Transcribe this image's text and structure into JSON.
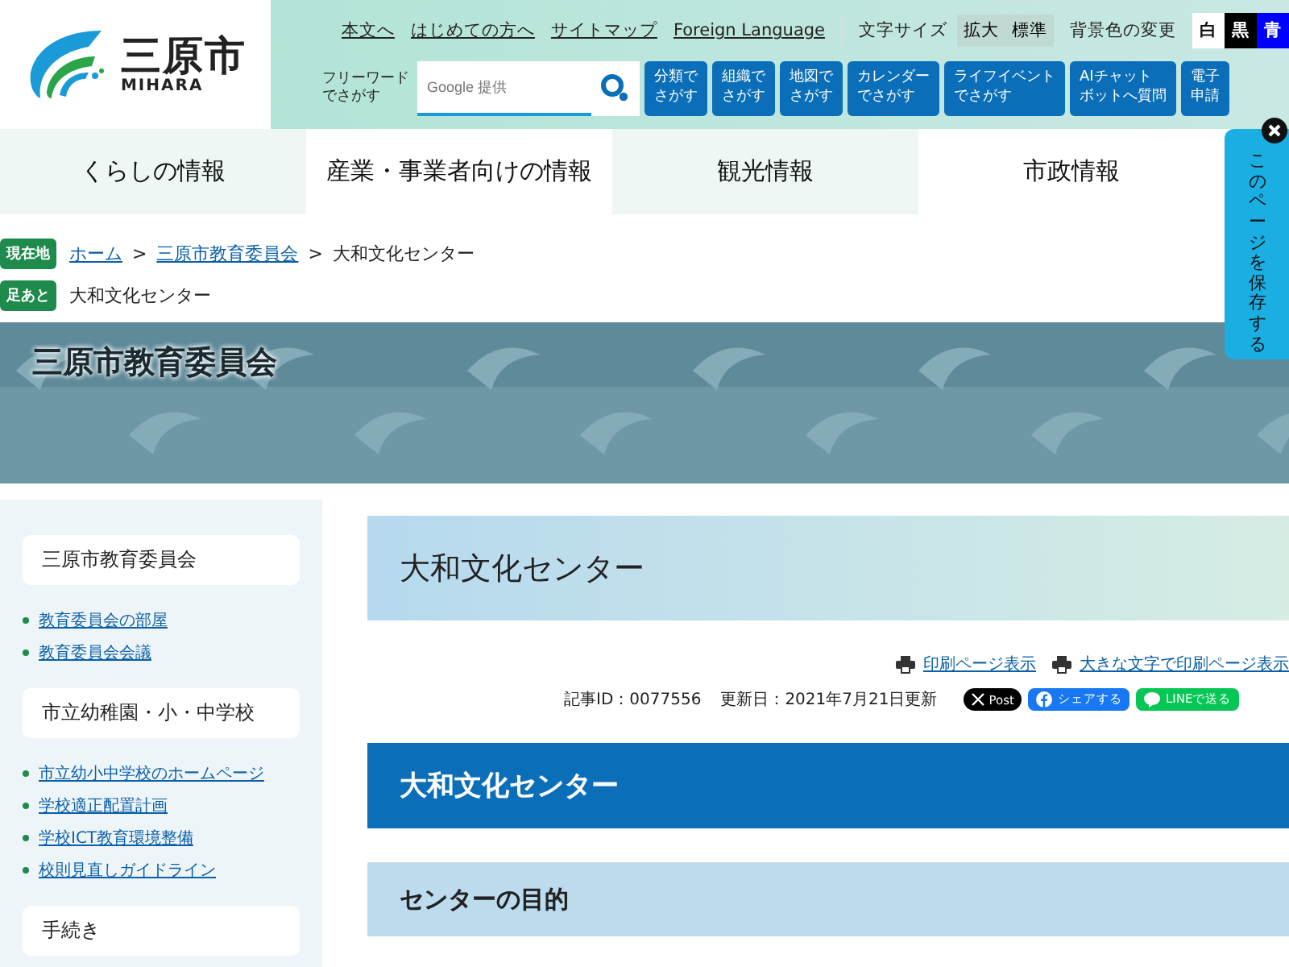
{
  "logo": {
    "name": "三原市",
    "subtitle": "MIHARA"
  },
  "utility_links": [
    "本文へ",
    "はじめての方へ",
    "サイトマップ",
    "Foreign Language"
  ],
  "font_size": {
    "label": "文字サイズ",
    "options": [
      "拡大",
      "標準"
    ]
  },
  "background_color": {
    "label": "背景色の変更",
    "options": [
      {
        "label": "白",
        "color": "#ffffff"
      },
      {
        "label": "黒",
        "color": "#000000"
      },
      {
        "label": "青",
        "color": "#0000ff"
      }
    ]
  },
  "search": {
    "label": [
      "フリーワード",
      "でさがす"
    ],
    "placeholder": "Google 提供"
  },
  "quick_buttons": [
    [
      "分類で",
      "さがす"
    ],
    [
      "組織で",
      "さがす"
    ],
    [
      "地図で",
      "さがす"
    ],
    [
      "カレンダー",
      "でさがす"
    ],
    [
      "ライフイベント",
      "でさがす"
    ],
    [
      "AIチャット",
      "ボットへ質問"
    ],
    [
      "電子",
      "申請"
    ]
  ],
  "main_nav": [
    "くらしの情報",
    "産業・事業者向けの情報",
    "観光情報",
    "市政情報"
  ],
  "breadcrumb": {
    "badge": "現在地",
    "separator": ">",
    "items": [
      {
        "label": "ホーム",
        "link": true
      },
      {
        "label": "三原市教育委員会",
        "link": true
      },
      {
        "label": "大和文化センター",
        "link": false
      }
    ]
  },
  "footprint": {
    "badge": "足あと",
    "text": "大和文化センター"
  },
  "banner": {
    "title": "三原市教育委員会"
  },
  "save_tab": {
    "label": "このページを保存する"
  },
  "sidebar": {
    "sections": [
      {
        "title": "三原市教育委員会",
        "links": [
          "教育委員会の部屋",
          "教育委員会会議"
        ]
      },
      {
        "title": "市立幼稚園・小・中学校",
        "links": [
          "市立幼小中学校のホームページ",
          "学校適正配置計画",
          "学校ICT教育環境整備",
          "校則見直しガイドライン"
        ]
      },
      {
        "title": "手続き"
      }
    ]
  },
  "article": {
    "title": "大和文化センター",
    "print_links": [
      "印刷ページ表示",
      "大きな文字で印刷ページ表示"
    ],
    "article_id": "記事ID：0077556",
    "updated": "更新日：2021年7月21日更新",
    "share_buttons": [
      {
        "kind": "x",
        "label": "Post"
      },
      {
        "kind": "facebook",
        "label": "シェアする"
      },
      {
        "kind": "line",
        "label": "LINEで送る"
      }
    ],
    "heading": "大和文化センター",
    "subheading": "センターの目的"
  }
}
